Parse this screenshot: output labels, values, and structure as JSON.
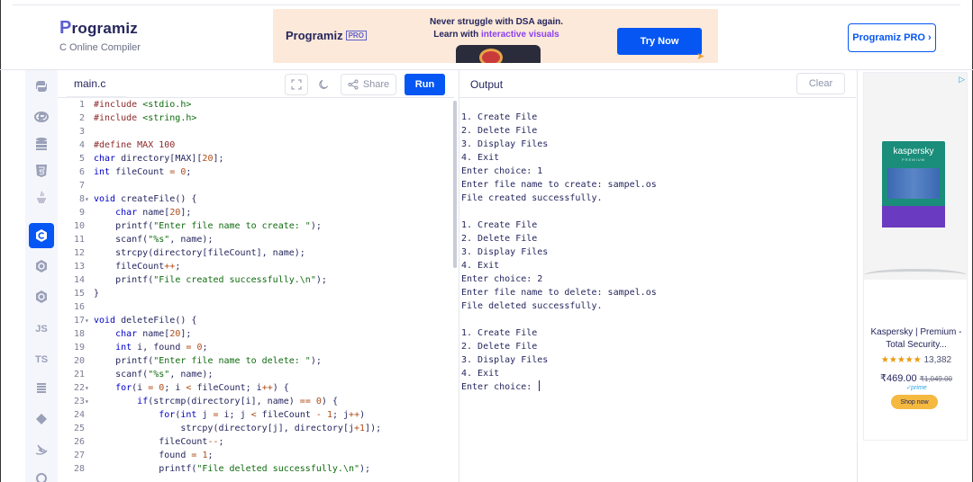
{
  "header": {
    "logo_text": "rogramiz",
    "logo_letter": "P",
    "logo_subtitle": "C Online Compiler",
    "pro_button": "Programiz PRO ›"
  },
  "banner": {
    "logo_text": "Programiz",
    "logo_badge": "PRO",
    "headline": "Never struggle with DSA again.",
    "subline_prefix": "Learn with ",
    "subline_accent": "interactive visuals",
    "cta": "Try Now"
  },
  "sidebar": {
    "items": [
      {
        "name": "python-icon",
        "glyph": ""
      },
      {
        "name": "r-icon",
        "glyph": ""
      },
      {
        "name": "sql-icon",
        "glyph": ""
      },
      {
        "name": "html-icon",
        "glyph": ""
      },
      {
        "name": "java-icon",
        "glyph": ""
      },
      {
        "name": "c-icon",
        "glyph": ""
      },
      {
        "name": "cpp-icon",
        "glyph": ""
      },
      {
        "name": "csharp-icon",
        "glyph": ""
      },
      {
        "name": "js-icon",
        "glyph": "JS"
      },
      {
        "name": "ts-icon",
        "glyph": "TS"
      },
      {
        "name": "go-icon",
        "glyph": ""
      },
      {
        "name": "php-icon",
        "glyph": ""
      },
      {
        "name": "swift-icon",
        "glyph": ""
      },
      {
        "name": "rust-icon",
        "glyph": ""
      }
    ]
  },
  "editor": {
    "filename": "main.c",
    "share_label": "Share",
    "run_label": "Run",
    "lines": [
      {
        "n": "1",
        "f": "",
        "t": [
          [
            "dir",
            "#include "
          ],
          [
            "str",
            "<stdio.h>"
          ]
        ]
      },
      {
        "n": "2",
        "f": "",
        "t": [
          [
            "dir",
            "#include "
          ],
          [
            "str",
            "<string.h>"
          ]
        ]
      },
      {
        "n": "3",
        "f": "",
        "t": []
      },
      {
        "n": "4",
        "f": "",
        "t": [
          [
            "dir",
            "#define MAX 100"
          ]
        ]
      },
      {
        "n": "5",
        "f": "",
        "t": [
          [
            "kw",
            "char"
          ],
          [
            "",
            " directory[MAX]["
          ],
          [
            "num",
            "20"
          ],
          [
            "",
            "];"
          ]
        ]
      },
      {
        "n": "6",
        "f": "",
        "t": [
          [
            "kw",
            "int"
          ],
          [
            "",
            " fileCount "
          ],
          [
            "op",
            "="
          ],
          [
            "",
            " "
          ],
          [
            "num",
            "0"
          ],
          [
            "",
            ";"
          ]
        ]
      },
      {
        "n": "7",
        "f": "",
        "t": []
      },
      {
        "n": "8",
        "f": "▾",
        "t": [
          [
            "kw",
            "void"
          ],
          [
            "",
            " createFile() {"
          ]
        ]
      },
      {
        "n": "9",
        "f": "",
        "t": [
          [
            "",
            "    "
          ],
          [
            "kw",
            "char"
          ],
          [
            "",
            " name["
          ],
          [
            "num",
            "20"
          ],
          [
            "",
            "];"
          ]
        ]
      },
      {
        "n": "10",
        "f": "",
        "t": [
          [
            "",
            "    printf("
          ],
          [
            "str",
            "\"Enter file name to create: \""
          ],
          [
            "",
            ");"
          ]
        ]
      },
      {
        "n": "11",
        "f": "",
        "t": [
          [
            "",
            "    scanf("
          ],
          [
            "str",
            "\"%s\""
          ],
          [
            "",
            ", name);"
          ]
        ]
      },
      {
        "n": "12",
        "f": "",
        "t": [
          [
            "",
            "    strcpy(directory[fileCount], name);"
          ]
        ]
      },
      {
        "n": "13",
        "f": "",
        "t": [
          [
            "",
            "    fileCount"
          ],
          [
            "op",
            "++"
          ],
          [
            "",
            ";"
          ]
        ]
      },
      {
        "n": "14",
        "f": "",
        "t": [
          [
            "",
            "    printf("
          ],
          [
            "str",
            "\"File created successfully.\\n\""
          ],
          [
            "",
            ");"
          ]
        ]
      },
      {
        "n": "15",
        "f": "",
        "t": [
          [
            "",
            "}"
          ]
        ]
      },
      {
        "n": "16",
        "f": "",
        "t": []
      },
      {
        "n": "17",
        "f": "▾",
        "t": [
          [
            "kw",
            "void"
          ],
          [
            "",
            " deleteFile() {"
          ]
        ]
      },
      {
        "n": "18",
        "f": "",
        "t": [
          [
            "",
            "    "
          ],
          [
            "kw",
            "char"
          ],
          [
            "",
            " name["
          ],
          [
            "num",
            "20"
          ],
          [
            "",
            "];"
          ]
        ]
      },
      {
        "n": "19",
        "f": "",
        "t": [
          [
            "",
            "    "
          ],
          [
            "kw",
            "int"
          ],
          [
            "",
            " i, found "
          ],
          [
            "op",
            "="
          ],
          [
            "",
            " "
          ],
          [
            "num",
            "0"
          ],
          [
            "",
            ";"
          ]
        ]
      },
      {
        "n": "20",
        "f": "",
        "t": [
          [
            "",
            "    printf("
          ],
          [
            "str",
            "\"Enter file name to delete: \""
          ],
          [
            "",
            ");"
          ]
        ]
      },
      {
        "n": "21",
        "f": "",
        "t": [
          [
            "",
            "    scanf("
          ],
          [
            "str",
            "\"%s\""
          ],
          [
            "",
            ", name);"
          ]
        ]
      },
      {
        "n": "22",
        "f": "▾",
        "t": [
          [
            "",
            "    "
          ],
          [
            "kw",
            "for"
          ],
          [
            "",
            "(i "
          ],
          [
            "op",
            "="
          ],
          [
            "",
            " "
          ],
          [
            "num",
            "0"
          ],
          [
            "",
            "; i "
          ],
          [
            "op",
            "<"
          ],
          [
            "",
            " fileCount; i"
          ],
          [
            "op",
            "++"
          ],
          [
            "",
            ") {"
          ]
        ]
      },
      {
        "n": "23",
        "f": "▾",
        "t": [
          [
            "",
            "        "
          ],
          [
            "kw",
            "if"
          ],
          [
            "",
            "(strcmp(directory[i], name) "
          ],
          [
            "op",
            "=="
          ],
          [
            "",
            " "
          ],
          [
            "num",
            "0"
          ],
          [
            "",
            ") {"
          ]
        ]
      },
      {
        "n": "24",
        "f": "",
        "t": [
          [
            "",
            "            "
          ],
          [
            "kw",
            "for"
          ],
          [
            "",
            "("
          ],
          [
            "kw",
            "int"
          ],
          [
            "",
            " j "
          ],
          [
            "op",
            "="
          ],
          [
            "",
            " i; j "
          ],
          [
            "op",
            "<"
          ],
          [
            "",
            " fileCount "
          ],
          [
            "op",
            "-"
          ],
          [
            "",
            " "
          ],
          [
            "num",
            "1"
          ],
          [
            "",
            "; j"
          ],
          [
            "op",
            "++"
          ],
          [
            "",
            ")"
          ]
        ]
      },
      {
        "n": "25",
        "f": "",
        "t": [
          [
            "",
            "                strcpy(directory[j], directory[j"
          ],
          [
            "op",
            "+"
          ],
          [
            "num",
            "1"
          ],
          [
            "",
            "]);"
          ]
        ]
      },
      {
        "n": "26",
        "f": "",
        "t": [
          [
            "",
            "            fileCount"
          ],
          [
            "op",
            "--"
          ],
          [
            "",
            ";"
          ]
        ]
      },
      {
        "n": "27",
        "f": "",
        "t": [
          [
            "",
            "            found "
          ],
          [
            "op",
            "="
          ],
          [
            "",
            " "
          ],
          [
            "num",
            "1"
          ],
          [
            "",
            ";"
          ]
        ]
      },
      {
        "n": "28",
        "f": "",
        "t": [
          [
            "",
            "            printf("
          ],
          [
            "str",
            "\"File deleted successfully.\\n\""
          ],
          [
            "",
            ");"
          ]
        ]
      }
    ]
  },
  "output": {
    "title": "Output",
    "clear_label": "Clear",
    "lines": [
      "1. Create File",
      "2. Delete File",
      "3. Display Files",
      "4. Exit",
      "Enter choice: 1",
      "Enter file name to create: sampel.os",
      "File created successfully.",
      "",
      "1. Create File",
      "2. Delete File",
      "3. Display Files",
      "4. Exit",
      "Enter choice: 2",
      "Enter file name to delete: sampel.os",
      "File deleted successfully.",
      "",
      "1. Create File",
      "2. Delete File",
      "3. Display Files",
      "4. Exit",
      "Enter choice: "
    ]
  },
  "ad": {
    "brand": "kaspersky",
    "brand_sub": "PREMIUM",
    "title": "Kaspersky | Premium - Total Security...",
    "stars": "★★★★★",
    "reviews": "13,382",
    "price": "₹469.00",
    "price_strike": "₹1,049.00",
    "prime": "✓prime",
    "shop": "Shop now",
    "adchoice": "▷"
  },
  "colors": {
    "accent": "#0556f3",
    "keyword": "#0000c8",
    "directive": "#8d2a2a",
    "string": "#0f6b0f",
    "number": "#b04a16"
  }
}
